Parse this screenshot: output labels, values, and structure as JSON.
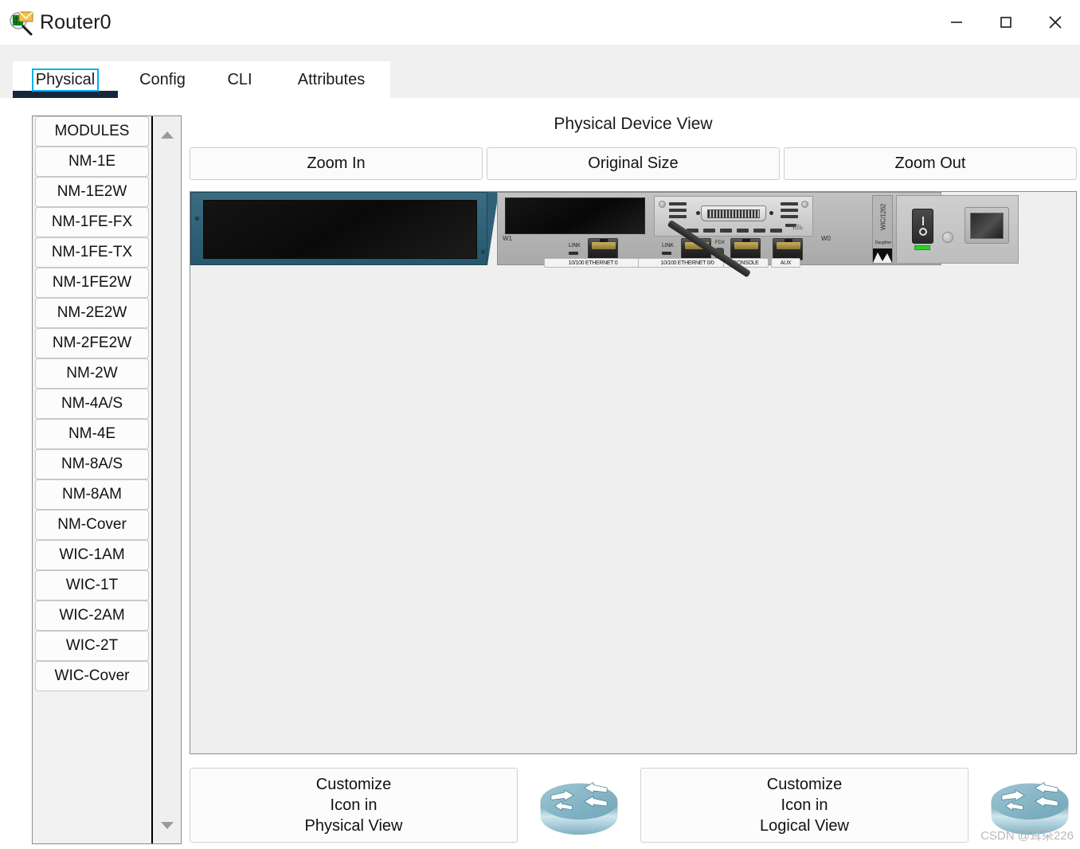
{
  "window": {
    "title": "Router0",
    "icon": "inspect-device-icon",
    "controls": {
      "minimize": "—",
      "maximize": "☐",
      "close": "✕"
    }
  },
  "tabs": [
    {
      "label": "Physical",
      "active": true
    },
    {
      "label": "Config",
      "active": false
    },
    {
      "label": "CLI",
      "active": false
    },
    {
      "label": "Attributes",
      "active": false
    }
  ],
  "sidebar": {
    "header": "MODULES",
    "items": [
      "NM-1E",
      "NM-1E2W",
      "NM-1FE-FX",
      "NM-1FE-TX",
      "NM-1FE2W",
      "NM-2E2W",
      "NM-2FE2W",
      "NM-2W",
      "NM-4A/S",
      "NM-4E",
      "NM-8A/S",
      "NM-8AM",
      "NM-Cover",
      "WIC-1AM",
      "WIC-1T",
      "WIC-2AM",
      "WIC-2T",
      "WIC-Cover"
    ],
    "scroll_up": "scroll-up-arrow",
    "scroll_down": "scroll-down-arrow"
  },
  "main": {
    "view_title": "Physical Device View",
    "zoom_buttons": [
      "Zoom In",
      "Original Size",
      "Zoom Out"
    ]
  },
  "device": {
    "slot_label_w1": "W1",
    "slot_label_w0": "W0",
    "link_label_left": "LINK",
    "link_label_right": "LINK",
    "fdx_label": "FDX",
    "port_tags": [
      "10/100 ETHERNET 0",
      "10/100 ETHERNET 0/0",
      "CONSOLE",
      "AUX"
    ],
    "wic_strip_text": "WIC/1262",
    "wic_modem_label": "Daughter"
  },
  "bottom": {
    "customize_physical": {
      "line1": "Customize",
      "line2": "Icon in",
      "line3": "Physical View"
    },
    "customize_logical": {
      "line1": "Customize",
      "line2": "Icon in",
      "line3": "Logical View"
    },
    "router_icon": "cisco-router-icon"
  },
  "watermark": "CSDN @耳朵226",
  "colors": {
    "accent_focus": "#00b0f0",
    "tab_underline": "#16263f",
    "module_bay_teal": "#2f6076",
    "power_led_green": "#27d327",
    "router_icon_teal": "#7fb3c3",
    "panel_bg": "#efefef"
  }
}
